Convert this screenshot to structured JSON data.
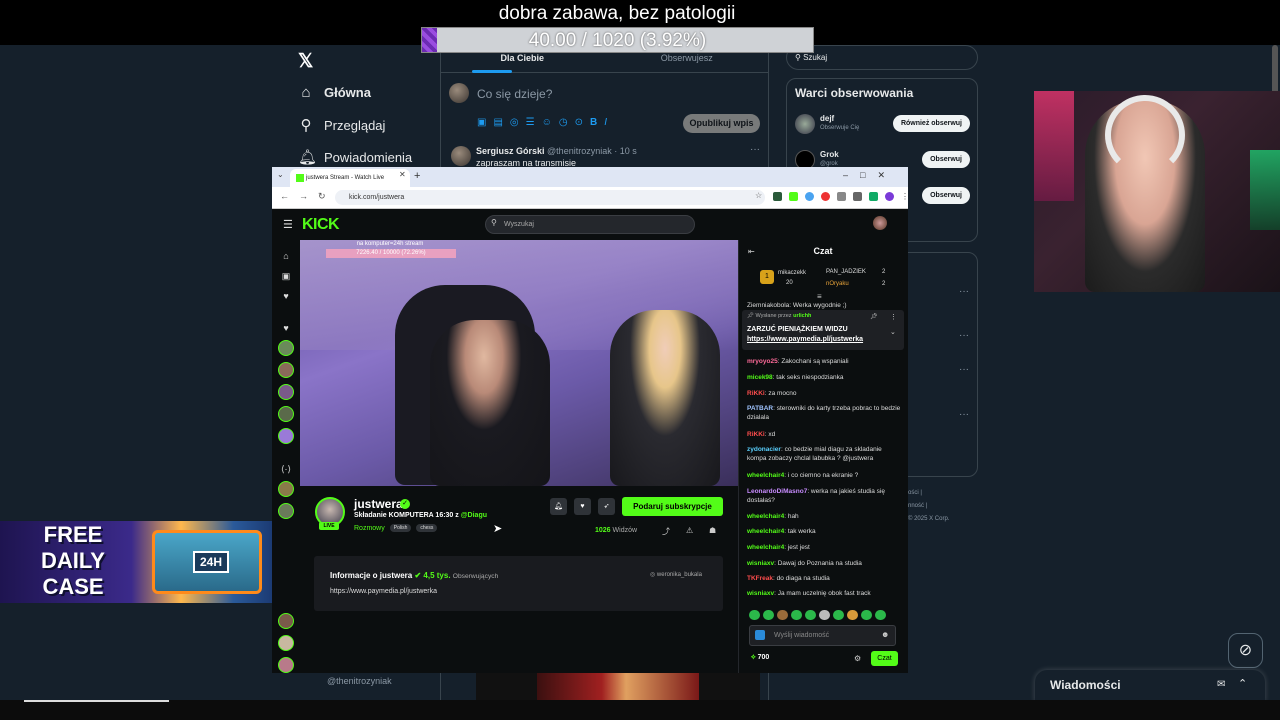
{
  "overlay": {
    "title": "dobra zabawa, bez patologii",
    "goal_text": "40.00 / 1020 (3.92%)",
    "goal_fraction": 0.0392
  },
  "x": {
    "nav": [
      {
        "icon": "home-icon",
        "label": "Główna"
      },
      {
        "icon": "search-icon",
        "label": "Przeglądaj"
      },
      {
        "icon": "bell-icon",
        "label": "Powiadomienia"
      }
    ],
    "tabs": [
      "Dla Ciebie",
      "Obserwujesz"
    ],
    "compose_placeholder": "Co się dzieje?",
    "post_button": "Opublikuj wpis",
    "tweet": {
      "name": "Sergiusz Górski",
      "handle": "@thenitrozyniak · 10 s",
      "text": "zapraszam na transmisie"
    },
    "search_placeholder": "Szukaj",
    "follow_title": "Warci obserwowania",
    "follow": [
      {
        "name": "dejf",
        "sub": "Obserwuje Cię",
        "button": "Również obserwuj"
      },
      {
        "name": "Grok",
        "sub": "@grok",
        "button": "Obserwuj"
      },
      {
        "name": "",
        "sub": "",
        "button": "Obserwuj"
      }
    ],
    "footer": [
      "ości |",
      "nność |",
      "© 2025 X Corp."
    ],
    "profile_handle": "@thenitrozyniak",
    "messages_label": "Wiadomości"
  },
  "ad": {
    "line1": "FREE",
    "line2": "DAILY",
    "line3": "CASE",
    "badge": "24H"
  },
  "browser": {
    "tab_title": "justwera Stream - Watch Live",
    "url": "kick.com/justwera",
    "search_placeholder": "Wyszukaj"
  },
  "stream": {
    "overlay_text": "na komputer=24h stream",
    "overlay_bar": "7226.40 / 10000 (72.26%)",
    "streamer": "justwera",
    "title_prefix": "Składanie KOMPUTERA 16:30 z",
    "title_mention": "@Diagu",
    "category": "Rozmowy",
    "tags": [
      "Polish",
      "chess"
    ],
    "live_badge": "LIVE",
    "subscribe_label": "Podaruj subskrypcje",
    "viewers": "1026",
    "viewers_label": "Widzów",
    "about_title": "Informacje o justwera",
    "followers": "4,5 tys.",
    "followers_label": "Obserwujących",
    "about_link": "https://www.paymedia.pl/justwerka",
    "about_social": "weronika_bukala"
  },
  "chat": {
    "title": "Czat",
    "leaderboard": [
      {
        "name": "mikaczekk",
        "count": "20"
      },
      {
        "name": "PAN_JADZIEK",
        "count": "2"
      },
      {
        "name": "nOryaku",
        "count": "2"
      }
    ],
    "partial_line": "Ziemniakobola: Werka wygodnie ;)",
    "pinned_by_label": "Wysłane przez",
    "pinned_by_user": "urlichh",
    "pinned_message": "ZARZUĆ PIENIĄŻKIEM WIDZU",
    "pinned_url": "https://www.paymedia.pl/justwerka",
    "messages": [
      {
        "user": "mryoyo25",
        "color": "#ff6b9a",
        "text": ": Zakochani są wspaniali"
      },
      {
        "user": "micek98",
        "color": "#53fc18",
        "text": ": tak seks niespodzianka"
      },
      {
        "user": "RiKKi",
        "color": "#ff4d4d",
        "text": ": za mocno"
      },
      {
        "user": "PATBAR",
        "color": "#a0c4ff",
        "text": ": sterowniki do karty trzeba pobrac to bedzie dzialala"
      },
      {
        "user": "RiKKi",
        "color": "#ff4d4d",
        "text": ": xd"
      },
      {
        "user": "zydonacier",
        "color": "#5ad1ff",
        "text": ": co bedzie mial diagu za skladanie kompa zobaczy chclal labubka ? @justwera"
      },
      {
        "user": "wheelchair4",
        "color": "#53fc18",
        "text": ": i co ciemno na ekranie ?"
      },
      {
        "user": "LeonardoDiMasno7",
        "color": "#c88cff",
        "text": ": werka na jakieś studia się dostałaś?"
      },
      {
        "user": "wheelchair4",
        "color": "#53fc18",
        "text": ": hah"
      },
      {
        "user": "wheelchair4",
        "color": "#53fc18",
        "text": ": tak werka"
      },
      {
        "user": "wheelchair4",
        "color": "#53fc18",
        "text": ": jest jest"
      },
      {
        "user": "wisniaxv",
        "color": "#53fc18",
        "text": ": Dawaj do Poznania na studia"
      },
      {
        "user": "TKFreak",
        "color": "#ff4d4d",
        "text": ": do diaga na studia"
      },
      {
        "user": "wisniaxv",
        "color": "#53fc18",
        "text": ": Ja mam uczelnię obok fast track"
      }
    ],
    "input_placeholder": "Wyślij wiadomość",
    "points": "700",
    "send_label": "Czat"
  }
}
